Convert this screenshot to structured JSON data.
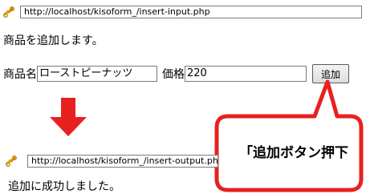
{
  "top_address_bar": {
    "url": "http://localhost/kisoform_/insert-input.php"
  },
  "input_page": {
    "message": "商品を追加します。",
    "name_label": "商品名",
    "name_value": "ローストピーナッツ",
    "price_label": "価格",
    "price_value": "220",
    "add_button_label": "追加"
  },
  "callout": {
    "text": "「追加ボタン押下"
  },
  "bottom_address_bar": {
    "url": "http://localhost/kisoform_/insert-output.php"
  },
  "output_page": {
    "message": "追加に成功しました。"
  },
  "colors": {
    "arrow_red": "#e82020",
    "callout_border": "#e82020",
    "link_icon": "#e8a317"
  }
}
